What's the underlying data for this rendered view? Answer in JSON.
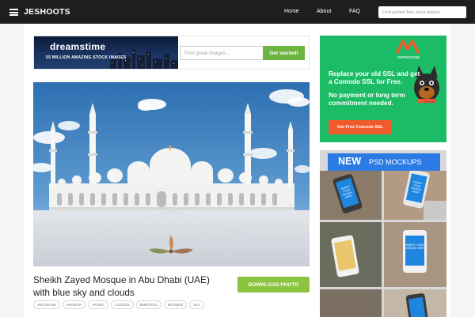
{
  "header": {
    "brand": "JESHOOTS",
    "nav": [
      "Home",
      "About",
      "FAQ"
    ],
    "search_placeholder": "Find perfect free stock photos"
  },
  "dreamstime_ad": {
    "logo": "dreamstime",
    "tagline": "55 MILLION AMAZING STOCK IMAGES",
    "search_placeholder": "Find great images...",
    "button": "Get started!"
  },
  "photo": {
    "title": "Sheikh Zayed Mosque in Abu Dhabi (UAE) with blue sky and clouds",
    "download_button": "DOWNLOAD PHOTO",
    "tags": [
      "ABU DHABI",
      "ARABIAN",
      "ARABIC",
      "CLOUDS",
      "EMIRATES",
      "MOSQUE",
      "SKY"
    ]
  },
  "namecheap_ad": {
    "logo": "namecheap",
    "headline": "Replace your old SSL and  get a Comodo SSL for Free.",
    "subline": "No payment or long term commitment needed.",
    "button": "Get Free Comodo SSL",
    "colors": {
      "background": "#1bbc65",
      "button": "#f15a2b"
    }
  },
  "psd_ad": {
    "new": "NEW",
    "title": "PSD MOCKUPS",
    "screen_text": "INSERT YOUR DESIGN HERE"
  }
}
